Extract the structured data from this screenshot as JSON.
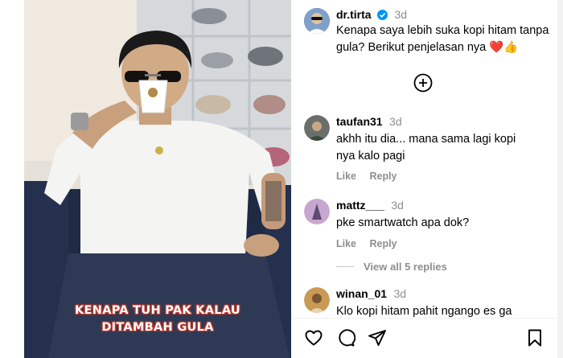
{
  "post": {
    "author": "dr.tirta",
    "verified": true,
    "time": "3d",
    "caption": "Kenapa saya lebih suka kopi hitam tanpa gula? Berikut penjelasan nya ❤️👍",
    "video_overlay_line1": "KENAPA TUH PAK KALAU",
    "video_overlay_line2": "DITAMBAH GULA"
  },
  "comments": [
    {
      "user": "taufan31",
      "time": "3d",
      "text": "akhh itu dia... mana sama lagi kopi nya kalo pagi",
      "like_label": "Like",
      "reply_label": "Reply"
    },
    {
      "user": "mattz___",
      "time": "3d",
      "text": "pke smartwatch apa dok?",
      "like_label": "Like",
      "reply_label": "Reply",
      "view_replies": "View all 5 replies"
    },
    {
      "user": "winan_01",
      "time": "3d",
      "text": "Klo kopi hitam pahit ngango es ga"
    }
  ],
  "actions": {
    "icons": [
      "heart-icon",
      "comment-icon",
      "share-icon",
      "bookmark-icon"
    ]
  },
  "colors": {
    "verified": "#0095f6",
    "overlay_text_stroke": "#c0392b",
    "muted": "#8e8e8e"
  }
}
